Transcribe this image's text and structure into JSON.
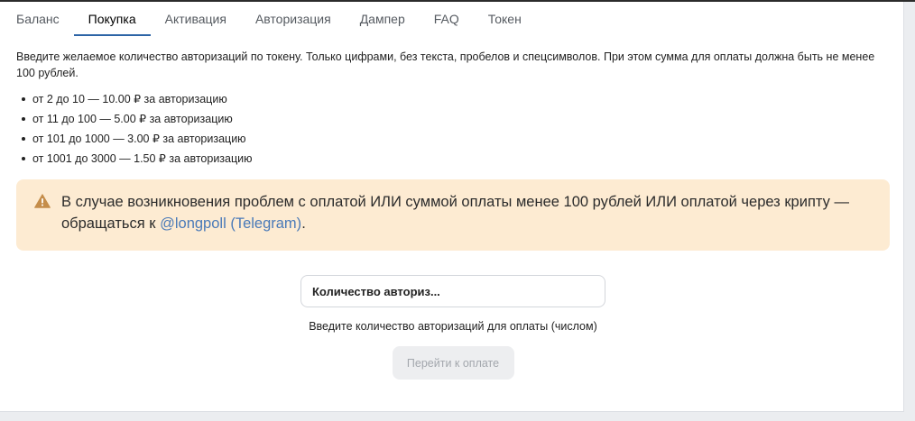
{
  "tabs": [
    {
      "label": "Баланс",
      "active": false
    },
    {
      "label": "Покупка",
      "active": true
    },
    {
      "label": "Активация",
      "active": false
    },
    {
      "label": "Авторизация",
      "active": false
    },
    {
      "label": "Дампер",
      "active": false
    },
    {
      "label": "FAQ",
      "active": false
    },
    {
      "label": "Токен",
      "active": false
    }
  ],
  "intro": {
    "text": "Введите желаемое количество авторизаций по токену. Только цифрами, без текста, пробелов и спецсимволов. При этом сумма для оплаты должна быть не менее 100 рублей."
  },
  "prices": [
    "от 2 до 10 — 10.00 ₽ за авторизацию",
    "от 11 до 100 — 5.00 ₽ за авторизацию",
    "от 101 до 1000 — 3.00 ₽ за авторизацию",
    "от 1001 до 3000 — 1.50 ₽ за авторизацию"
  ],
  "alert": {
    "icon": "warning-icon",
    "text_before": "В случае возникновения проблем с оплатой ИЛИ суммой оплаты менее 100 рублей ИЛИ оплатой через крипту — обращаться к ",
    "link_text": "@longpoll (Telegram)",
    "text_after": ".",
    "background_color": "#fdebd2",
    "icon_color": "#c58d4a",
    "link_color": "#4a7ab8"
  },
  "form": {
    "input_placeholder": "Количество авториз...",
    "input_value": "",
    "hint": "Введите количество авторизаций для оплаты (числом)",
    "submit_label": "Перейти к оплате"
  },
  "colors": {
    "accent": "#2d64a6"
  }
}
